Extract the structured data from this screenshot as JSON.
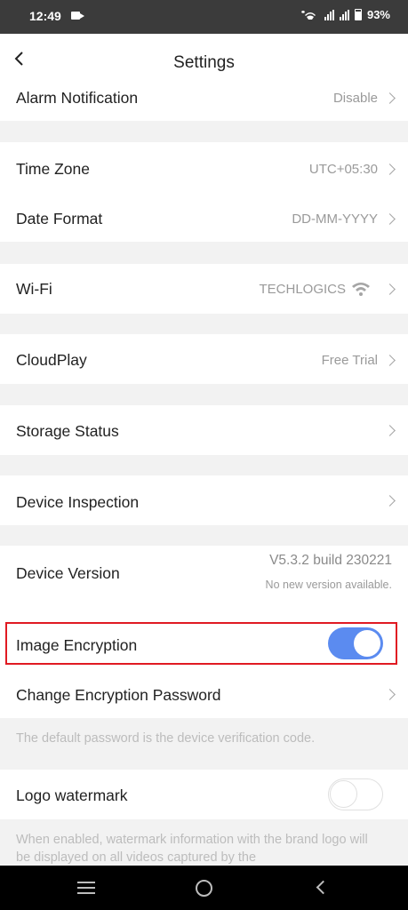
{
  "status_bar": {
    "time": "12:49",
    "battery": "93%"
  },
  "header": {
    "title": "Settings"
  },
  "rows": {
    "alarm": {
      "label": "Alarm Notification",
      "value": "Disable"
    },
    "timezone": {
      "label": "Time Zone",
      "value": "UTC+05:30"
    },
    "date_format": {
      "label": "Date Format",
      "value": "DD-MM-YYYY"
    },
    "wifi": {
      "label": "Wi-Fi",
      "value": "TECHLOGICS"
    },
    "cloudplay": {
      "label": "CloudPlay",
      "value": "Free Trial"
    },
    "storage": {
      "label": "Storage Status"
    },
    "inspection": {
      "label": "Device Inspection"
    },
    "version": {
      "label": "Device Version",
      "value": "V5.3.2 build 230221",
      "subvalue": "No new version available."
    },
    "image_encryption": {
      "label": "Image Encryption",
      "enabled": true
    },
    "change_password": {
      "label": "Change Encryption Password"
    },
    "logo_watermark": {
      "label": "Logo watermark",
      "enabled": false
    }
  },
  "notes": {
    "password_note": "The default password is the device verification code.",
    "watermark_note": "When enabled, watermark information with the brand logo will be displayed on all videos captured by the"
  },
  "colors": {
    "accent": "#5b8bf0",
    "highlight": "#e01a22"
  }
}
